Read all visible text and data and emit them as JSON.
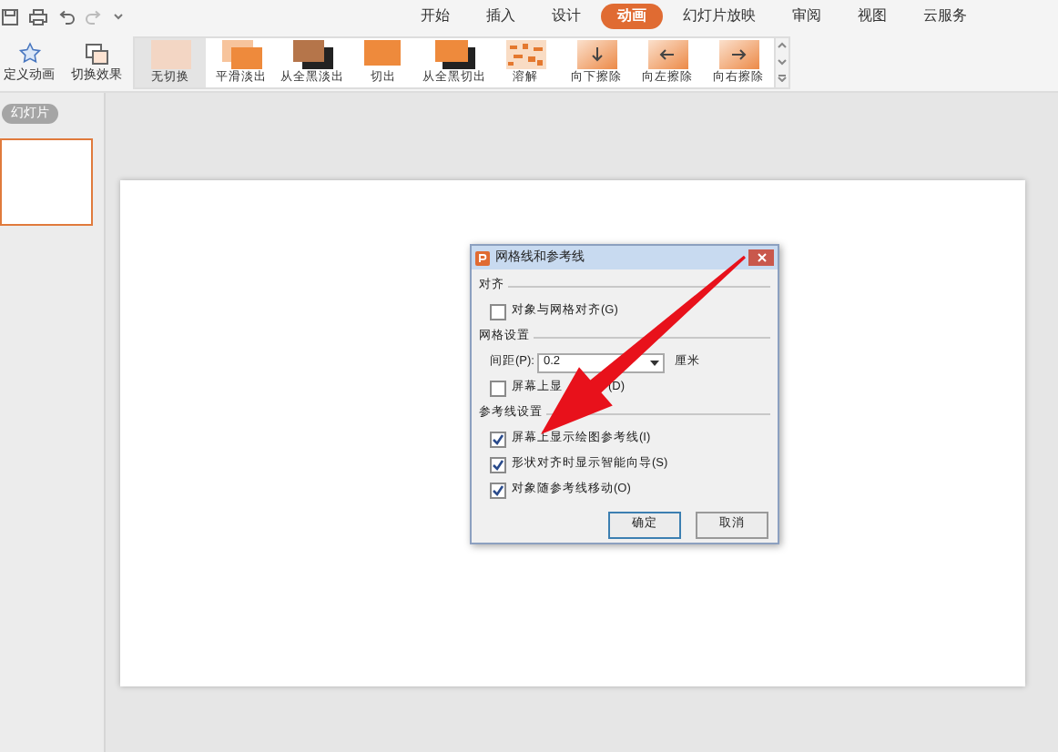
{
  "menu_tabs": [
    {
      "label": "开始",
      "selected": false
    },
    {
      "label": "插入",
      "selected": false
    },
    {
      "label": "设计",
      "selected": false
    },
    {
      "label": "动画",
      "selected": true
    },
    {
      "label": "幻灯片放映",
      "selected": false
    },
    {
      "label": "审阅",
      "selected": false
    },
    {
      "label": "视图",
      "selected": false
    },
    {
      "label": "云服务",
      "selected": false
    }
  ],
  "ribbon": {
    "custom_animation": "定义动画",
    "transition_effect": "切换效果",
    "gallery": [
      {
        "label": "无切换",
        "selected": true,
        "kind": "none"
      },
      {
        "label": "平滑淡出",
        "selected": false,
        "kind": "fade"
      },
      {
        "label": "从全黑淡出",
        "selected": false,
        "kind": "fadeblack"
      },
      {
        "label": "切出",
        "selected": false,
        "kind": "cut"
      },
      {
        "label": "从全黑切出",
        "selected": false,
        "kind": "cutblack"
      },
      {
        "label": "溶解",
        "selected": false,
        "kind": "dissolve"
      },
      {
        "label": "向下擦除",
        "selected": false,
        "kind": "down"
      },
      {
        "label": "向左擦除",
        "selected": false,
        "kind": "left"
      },
      {
        "label": "向右擦除",
        "selected": false,
        "kind": "right"
      }
    ]
  },
  "sidebar": {
    "tab": "幻灯片"
  },
  "dialog": {
    "title": "网格线和参考线",
    "align": {
      "heading": "对齐",
      "options": [
        {
          "label": "对象与网格对齐(G)",
          "checked": false
        }
      ]
    },
    "grid": {
      "heading": "网格设置",
      "spacing_label": "间距(P):",
      "spacing_value": "0.2",
      "unit": "厘米",
      "show_grid": {
        "label_start": "屏幕上显",
        "label_end": "(D)",
        "checked": false
      }
    },
    "guides": {
      "heading": "参考线设置",
      "options": [
        {
          "label": "屏幕上显示绘图参考线(I)",
          "checked": true
        },
        {
          "label": "形状对齐时显示智能向导(S)",
          "checked": true
        },
        {
          "label": "对象随参考线移动(O)",
          "checked": true
        }
      ]
    },
    "buttons": [
      "确定",
      "取消"
    ]
  }
}
